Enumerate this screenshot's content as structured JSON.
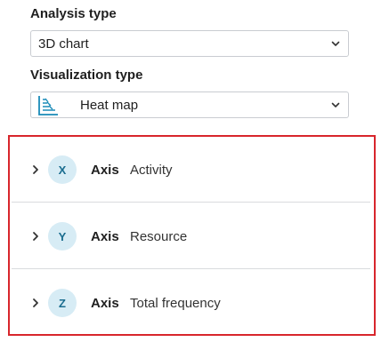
{
  "analysis": {
    "label": "Analysis type",
    "selected": "3D chart"
  },
  "visualization": {
    "label": "Visualization type",
    "selected": "Heat map",
    "icon": "heatmap-chart-icon"
  },
  "axes": [
    {
      "badge": "X",
      "title": "Axis",
      "value": "Activity"
    },
    {
      "badge": "Y",
      "title": "Axis",
      "value": "Resource"
    },
    {
      "badge": "Z",
      "title": "Axis",
      "value": "Total frequency"
    }
  ],
  "colors": {
    "highlight_border": "#d8262c",
    "badge_bg": "#d7ecf5",
    "badge_text": "#1a6d8f",
    "icon_accent": "#1a8bb8"
  }
}
